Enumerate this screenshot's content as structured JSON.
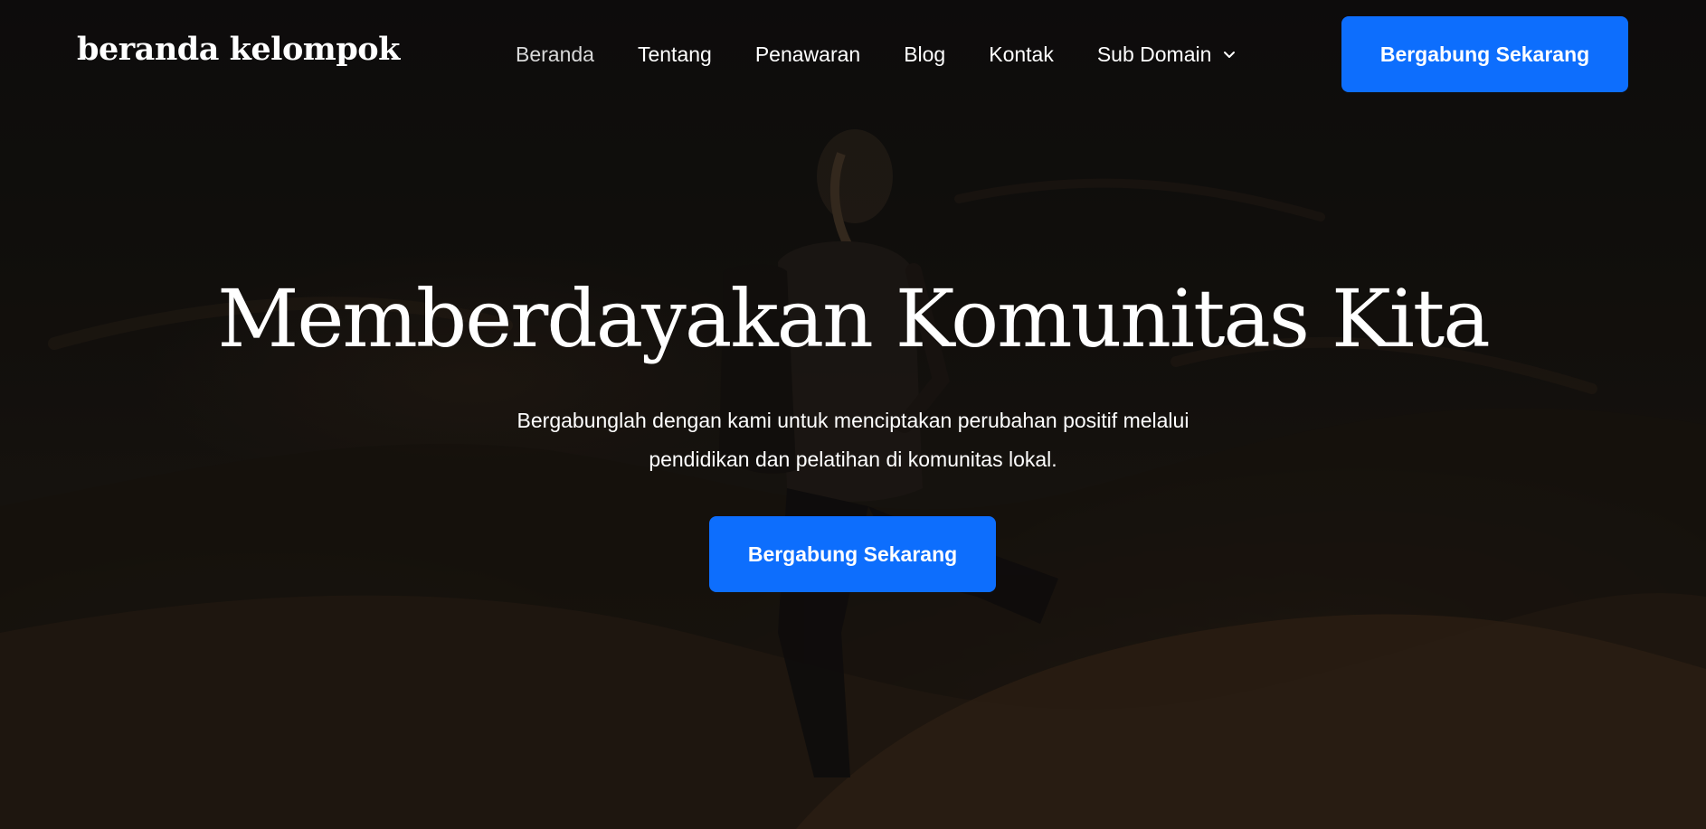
{
  "header": {
    "brand": "beranda kelompok",
    "nav": {
      "items": [
        {
          "label": "Beranda",
          "active": true
        },
        {
          "label": "Tentang"
        },
        {
          "label": "Penawaran"
        },
        {
          "label": "Blog"
        },
        {
          "label": "Kontak"
        },
        {
          "label": "Sub Domain",
          "dropdown": true,
          "icon": "chevron-down-icon"
        }
      ]
    },
    "cta_label": "Bergabung Sekarang"
  },
  "hero": {
    "title": "Memberdayakan Komunitas Kita",
    "subtitle_line1": "Bergabunglah dengan kami untuk menciptakan perubahan positif melalui",
    "subtitle_line2": "pendidikan dan pelatihan di komunitas lokal.",
    "cta_label": "Bergabung Sekarang",
    "background_image": "desert-hiker-photo"
  },
  "colors": {
    "accent": "#0d6efd",
    "text": "#ffffff",
    "nav_active": "#d9d9d9"
  }
}
